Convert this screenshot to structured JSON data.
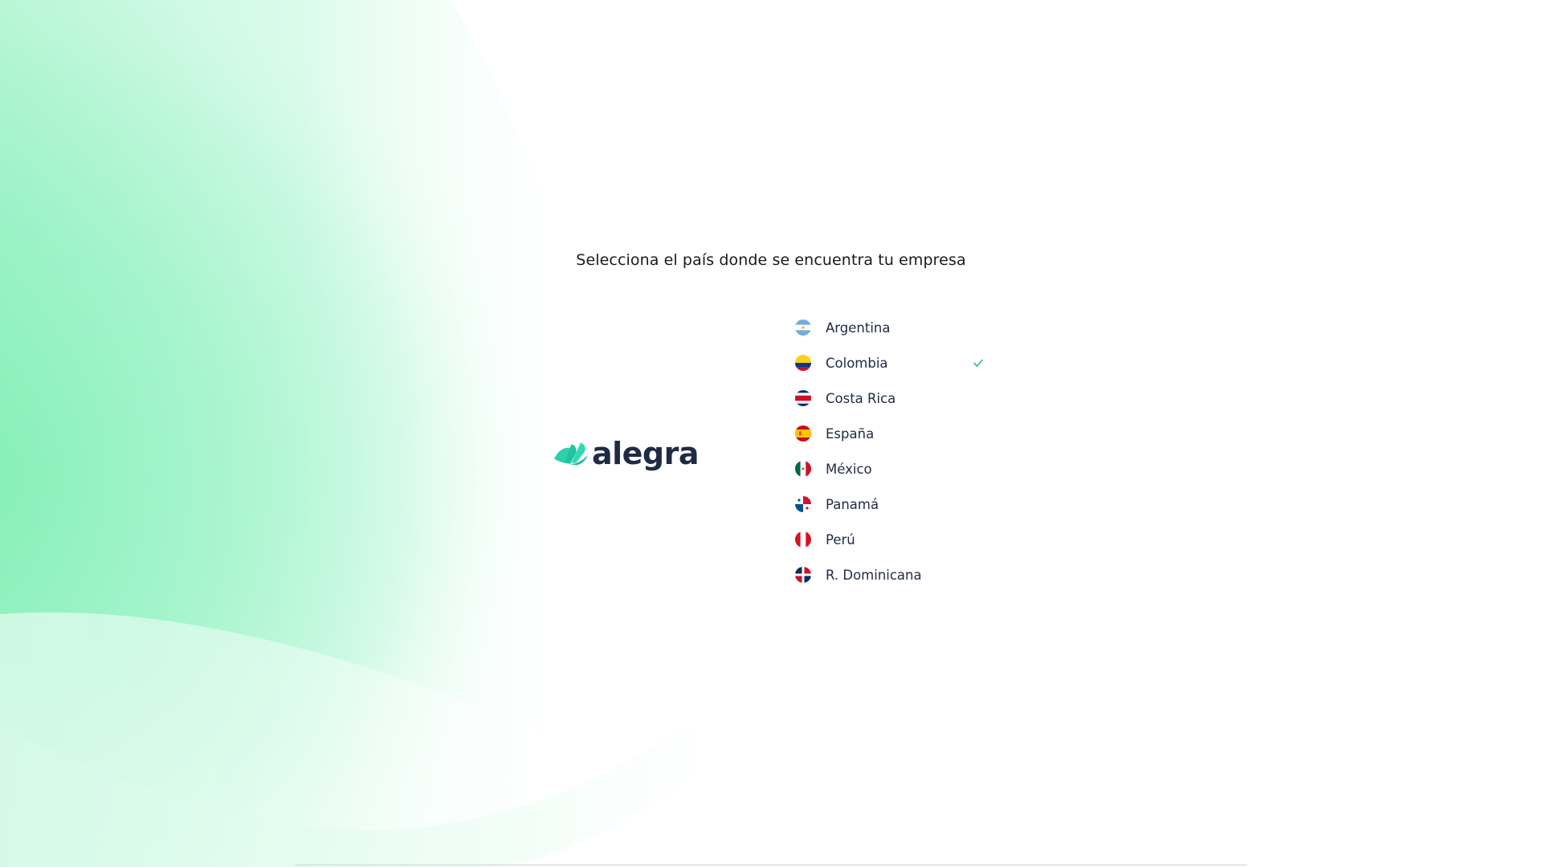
{
  "page": {
    "prompt": "Selecciona el país donde se encuentra tu empresa"
  },
  "brand": {
    "name": "alegra",
    "color": "#1f2a44",
    "accent": "#2ccfae"
  },
  "countries": {
    "selected": "Colombia",
    "items": [
      {
        "label": "Argentina",
        "icon": "flag-argentina-icon",
        "selected": false
      },
      {
        "label": "Colombia",
        "icon": "flag-colombia-icon",
        "selected": true
      },
      {
        "label": "Costa Rica",
        "icon": "flag-costa-rica-icon",
        "selected": false
      },
      {
        "label": "España",
        "icon": "flag-spain-icon",
        "selected": false
      },
      {
        "label": "México",
        "icon": "flag-mexico-icon",
        "selected": false
      },
      {
        "label": "Panamá",
        "icon": "flag-panama-icon",
        "selected": false
      },
      {
        "label": "Perú",
        "icon": "flag-peru-icon",
        "selected": false
      },
      {
        "label": "R. Dominicana",
        "icon": "flag-dominican-republic-icon",
        "selected": false
      }
    ]
  },
  "colors": {
    "check": "#30b892",
    "gradient_green": "#86f0b8"
  }
}
